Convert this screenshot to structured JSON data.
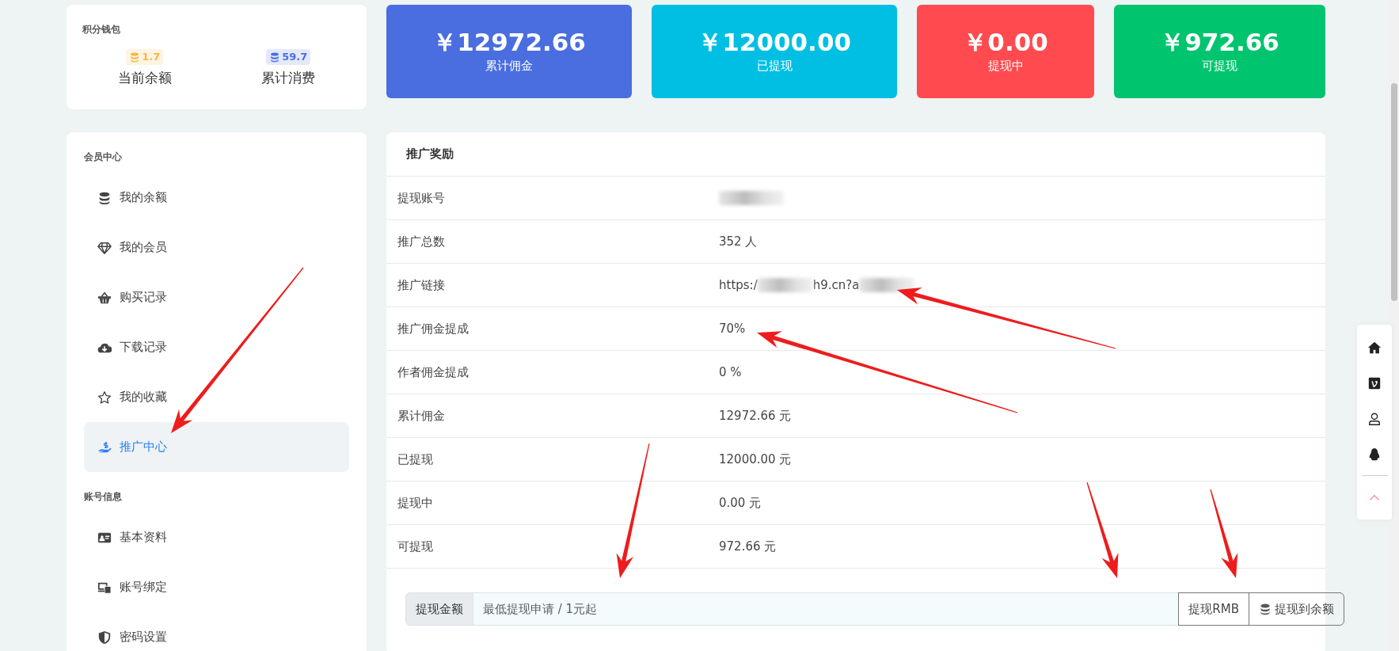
{
  "wallet": {
    "title": "积分钱包",
    "items": [
      {
        "value": "1.7",
        "label": "当前余额",
        "color": "#f5b640"
      },
      {
        "value": "59.7",
        "label": "累计消费",
        "color": "#4a6ee0"
      }
    ]
  },
  "stats": [
    {
      "amount": "￥12972.66",
      "label": "累计佣金",
      "color": "#4a6ee0"
    },
    {
      "amount": "￥12000.00",
      "label": "已提现",
      "color": "#00bfe3"
    },
    {
      "amount": "￥0.00",
      "label": "提现中",
      "color": "#ff4b4f"
    },
    {
      "amount": "￥972.66",
      "label": "可提现",
      "color": "#00c46e"
    }
  ],
  "sidebar": {
    "sections": [
      {
        "title": "会员中心",
        "items": [
          {
            "label": "我的余额",
            "selected": false
          },
          {
            "label": "我的会员",
            "selected": false
          },
          {
            "label": "购买记录",
            "selected": false
          },
          {
            "label": "下载记录",
            "selected": false
          },
          {
            "label": "我的收藏",
            "selected": false
          },
          {
            "label": "推广中心",
            "selected": true
          }
        ]
      },
      {
        "title": "账号信息",
        "items": [
          {
            "label": "基本资料",
            "selected": false
          },
          {
            "label": "账号绑定",
            "selected": false
          },
          {
            "label": "密码设置",
            "selected": false
          }
        ]
      }
    ]
  },
  "panel": {
    "title": "推广奖励",
    "rows": [
      {
        "label": "提现账号",
        "redacted": true
      },
      {
        "label": "推广总数",
        "value": "352 人"
      },
      {
        "label": "推广链接",
        "value_parts": [
          "https:/",
          "h9.cn?a"
        ],
        "redacted": true
      },
      {
        "label": "推广佣金提成",
        "value": "70%"
      },
      {
        "label": "作者佣金提成",
        "value": "0 %"
      },
      {
        "label": "累计佣金",
        "value": "12972.66 元"
      },
      {
        "label": "已提现",
        "value": "12000.00 元"
      },
      {
        "label": "提现中",
        "value": "0.00 元"
      },
      {
        "label": "可提现",
        "value": "972.66 元"
      }
    ]
  },
  "withdraw": {
    "addon": "提现金额",
    "placeholder": "最低提现申请 / 1元起",
    "buttons": [
      {
        "label": "提现RMB"
      },
      {
        "label": "提现到余额"
      }
    ]
  }
}
